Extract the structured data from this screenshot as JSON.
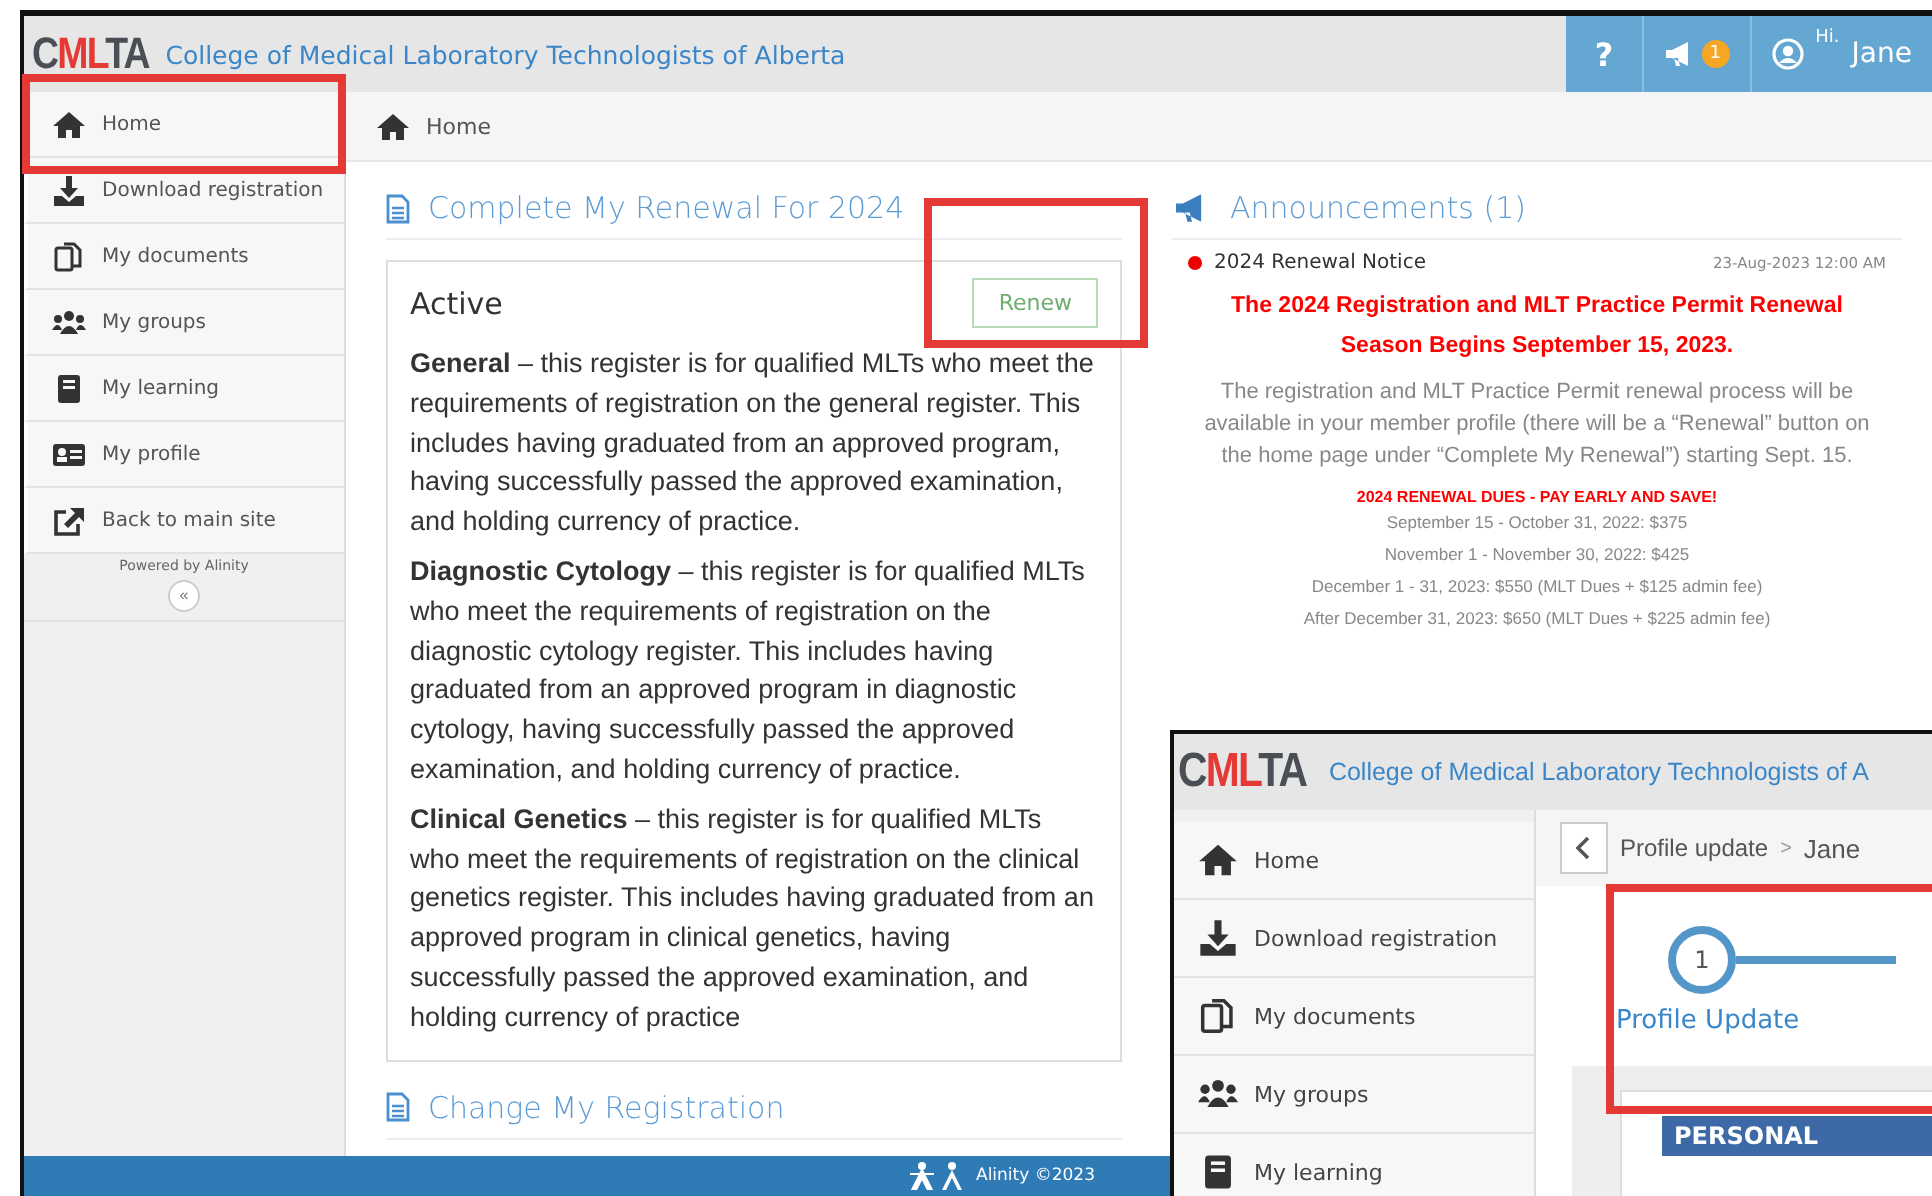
{
  "header": {
    "logo": {
      "left": "C",
      "middle": "ML",
      "right": "TA"
    },
    "title": "College of Medical Laboratory Technologists of Alberta",
    "help": "?",
    "notification_count": "1",
    "greeting": "Hi.",
    "user": "Jane"
  },
  "sidebar": {
    "items": [
      {
        "label": "Home",
        "kind": "home"
      },
      {
        "label": "Download registration",
        "kind": "download"
      },
      {
        "label": "My documents",
        "kind": "documents"
      },
      {
        "label": "My groups",
        "kind": "groups"
      },
      {
        "label": "My learning",
        "kind": "learning"
      },
      {
        "label": "My profile",
        "kind": "profile"
      },
      {
        "label": "Back to main site",
        "kind": "external"
      }
    ],
    "powered_by": "Powered by Alinity",
    "collapse": "«"
  },
  "breadcrumb": "Home",
  "renewal": {
    "title": "Complete My Renewal For 2024",
    "status": "Active",
    "button": "Renew",
    "paragraphs": [
      "**General** – this register is for qualified MLTs who meet the requirements of registration on the general register. This includes having graduated from an approved program, having successfully passed the approved examination, and holding currency of practice.",
      "**Diagnostic Cytology** – this register is for qualified MLTs who meet the requirements of registration on the diagnostic cytology register. This includes having graduated from an approved program in diagnostic cytology, having successfully passed the approved examination, and holding currency of practice.",
      "**Clinical Genetics** – this register is for qualified MLTs who meet the requirements of registration on the clinical genetics register. This includes having graduated from an approved program in clinical genetics, having successfully passed the approved examination, and holding currency of practice"
    ]
  },
  "change_title": "Change My Registration",
  "announcements": {
    "title": "Announcements (1)",
    "items": [
      {
        "title": "2024 Renewal Notice",
        "date": "23-Aug-2023 12:00 AM",
        "unread": true,
        "headline": "The 2024 Registration and MLT Practice Permit Renewal Season Begins September 15, 2023.",
        "body": "The registration and MLT Practice Permit renewal process will be available in your member profile (there will be a “Renewal” button on the home page under “Complete My Renewal”) starting Sept. 15.",
        "dues_title": "2024 RENEWAL DUES - PAY EARLY AND SAVE!",
        "dues": [
          "September 15 - October 31, 2022: $375",
          "November 1 - November 30, 2022: $425",
          "December 1 - 31, 2023: $550 (MLT Dues + $125 admin fee)",
          "After December 31, 2023: $650 (MLT Dues + $225 admin fee)"
        ]
      }
    ]
  },
  "footer": "Alinity ©2023",
  "inset": {
    "logo": {
      "left": "C",
      "middle": "ML",
      "right": "TA"
    },
    "title": "College of Medical Laboratory Technologists of A",
    "sidebar": [
      {
        "label": "Home",
        "kind": "home"
      },
      {
        "label": "Download registration",
        "kind": "download"
      },
      {
        "label": "My documents",
        "kind": "documents"
      },
      {
        "label": "My groups",
        "kind": "groups"
      },
      {
        "label": "My learning",
        "kind": "learning"
      }
    ],
    "breadcrumb": "Profile update",
    "separator": ">",
    "crumb_next": "Jane",
    "step": {
      "number": "1",
      "label": "Profile Update"
    },
    "section": "PERSONAL"
  }
}
